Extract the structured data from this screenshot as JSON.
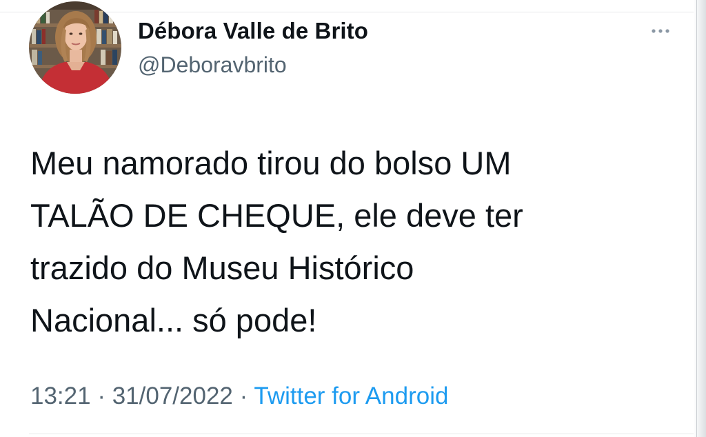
{
  "author": {
    "display_name": "Débora Valle de Brito",
    "handle": "@Deboravbrito"
  },
  "tweet": {
    "text": "Meu namorado tirou do bolso UM\nTALÃO DE CHEQUE, ele deve ter\ntrazido do Museu Histórico\nNacional... só pode!",
    "time": "13:21",
    "date": "31/07/2022",
    "separator": "·",
    "source": "Twitter for Android"
  },
  "icons": {
    "more": "more-horizontal-icon"
  },
  "colors": {
    "text": "#0f1419",
    "secondary": "#536471",
    "link": "#1d9bf0",
    "divider": "#e6e8ea"
  }
}
